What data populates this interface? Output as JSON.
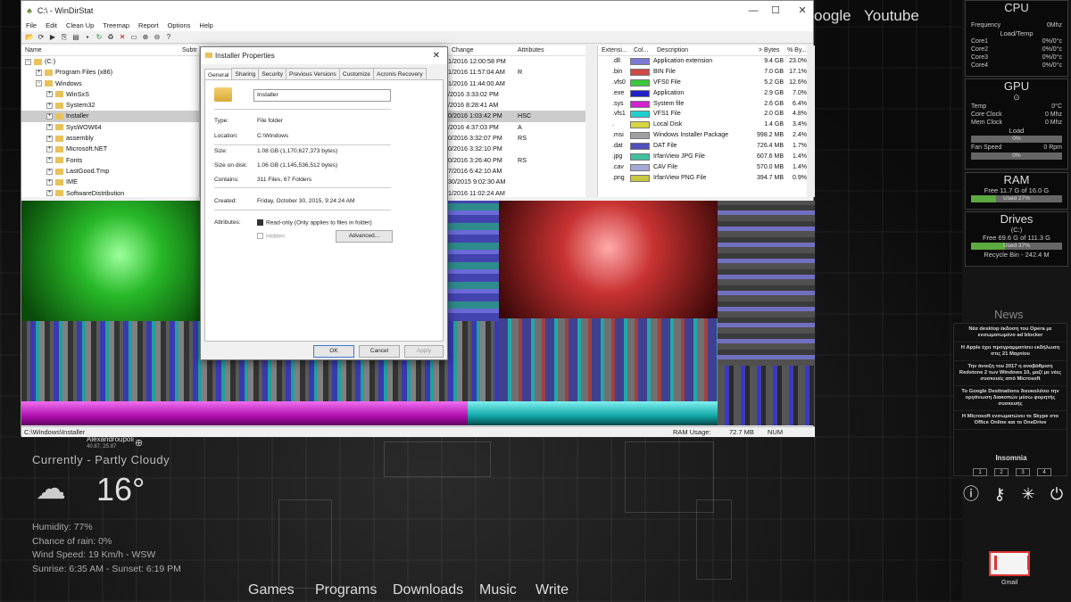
{
  "top_links": [
    "oogle",
    "Youtube"
  ],
  "window": {
    "title": "C:\\ - WinDirStat",
    "min": "—",
    "max": "☐",
    "close": "✕",
    "menu": [
      "File",
      "Edit",
      "Clean Up",
      "Treemap",
      "Report",
      "Options",
      "Help"
    ],
    "tree_headers": {
      "name": "Name",
      "subtree": "Subtr"
    },
    "tree": [
      {
        "label": "(C:)",
        "indent": 0,
        "exp": "−"
      },
      {
        "label": "Program Files (x86)",
        "indent": 1,
        "exp": "+"
      },
      {
        "label": "Windows",
        "indent": 1,
        "exp": "−"
      },
      {
        "label": "WinSxS",
        "indent": 2,
        "exp": "+"
      },
      {
        "label": "System32",
        "indent": 2,
        "exp": "+"
      },
      {
        "label": "Installer",
        "indent": 2,
        "exp": "+",
        "sel": true
      },
      {
        "label": "SysWOW64",
        "indent": 2,
        "exp": "+"
      },
      {
        "label": "assembly",
        "indent": 2,
        "exp": "+"
      },
      {
        "label": "Microsoft.NET",
        "indent": 2,
        "exp": "+"
      },
      {
        "label": "Fonts",
        "indent": 2,
        "exp": "+"
      },
      {
        "label": "LastGood.Tmp",
        "indent": 2,
        "exp": "+"
      },
      {
        "label": "IME",
        "indent": 2,
        "exp": "+"
      },
      {
        "label": "SoftwareDistribution",
        "indent": 2,
        "exp": "+"
      }
    ],
    "col_headers": {
      "change": "Change",
      "attributes": "Attributes"
    },
    "col_rows": [
      {
        "c": "1/2016 12:00:58 PM",
        "a": ""
      },
      {
        "c": "1/2016 11:57:04 AM",
        "a": "R"
      },
      {
        "c": "1/2016 11:44:00 AM",
        "a": ""
      },
      {
        "c": "/2016 3:33:02 PM",
        "a": ""
      },
      {
        "c": "/2016 8:28:41 AM",
        "a": ""
      },
      {
        "c": "0/2016 1:03:42 PM",
        "a": "HSC",
        "sel": true
      },
      {
        "c": "/2016 4:37:03 PM",
        "a": "A"
      },
      {
        "c": "0/2016 3:32:07 PM",
        "a": "RS"
      },
      {
        "c": "0/2016 3:32:10 PM",
        "a": ""
      },
      {
        "c": "0/2016 3:26:40 PM",
        "a": "RS"
      },
      {
        "c": "7/2016 6:42:10 AM",
        "a": ""
      },
      {
        "c": "30/2015 9:02:30 AM",
        "a": ""
      },
      {
        "c": "1/2016 11:02:24 AM",
        "a": ""
      }
    ],
    "ext_headers": {
      "ext": "Extensi...",
      "col": "Col...",
      "desc": "Description",
      "bytes": "> Bytes",
      "pct": "% By..."
    },
    "ext_rows": [
      {
        "e": ".dll",
        "color": "#7a7ad6",
        "d": "Application extension",
        "b": "9.4 GB",
        "p": "23.0%"
      },
      {
        "e": ".bin",
        "color": "#d04848",
        "d": "BIN File",
        "b": "7.0 GB",
        "p": "17.1%"
      },
      {
        "e": ".vfs0",
        "color": "#3cc83c",
        "d": "VFS0 File",
        "b": "5.2 GB",
        "p": "12.6%"
      },
      {
        "e": ".exe",
        "color": "#2020c8",
        "d": "Application",
        "b": "2.9 GB",
        "p": "7.0%"
      },
      {
        "e": ".sys",
        "color": "#d020d0",
        "d": "System file",
        "b": "2.6 GB",
        "p": "6.4%"
      },
      {
        "e": ".vfs1",
        "color": "#20d0d0",
        "d": "VFS1 File",
        "b": "2.0 GB",
        "p": "4.8%"
      },
      {
        "e": ".",
        "color": "#d6d640",
        "d": "Local Disk",
        "b": "1.4 GB",
        "p": "3.4%"
      },
      {
        "e": ".msi",
        "color": "#a0a0a0",
        "d": "Windows Installer Package",
        "b": "998.2 MB",
        "p": "2.4%"
      },
      {
        "e": ".dat",
        "color": "#5050b8",
        "d": "DAT File",
        "b": "726.4 MB",
        "p": "1.7%"
      },
      {
        "e": ".jpg",
        "color": "#40c0a0",
        "d": "IrfanView JPG File",
        "b": "607.6 MB",
        "p": "1.4%"
      },
      {
        "e": ".cav",
        "color": "#a8a8d8",
        "d": "CAV File",
        "b": "570.0 MB",
        "p": "1.4%"
      },
      {
        "e": ".png",
        "color": "#c8c840",
        "d": "IrfanView PNG File",
        "b": "394.7 MB",
        "p": "0.9%"
      }
    ],
    "status": {
      "path": "C:\\Windows\\Installer",
      "ram_label": "RAM Usage:",
      "ram_value": "72.7 MB",
      "num": "NUM"
    }
  },
  "dialog": {
    "title": "Installer Properties",
    "close": "✕",
    "tabs": [
      "General",
      "Sharing",
      "Security",
      "Previous Versions",
      "Customize",
      "Acronis Recovery"
    ],
    "name": "Installer",
    "type_label": "Type:",
    "type": "File folder",
    "location_label": "Location:",
    "location": "C:\\Windows",
    "size_label": "Size:",
    "size": "1.08 GB (1,170,627,373 bytes)",
    "disk_label": "Size on disk:",
    "disk": "1.06 GB (1,145,536,512 bytes)",
    "contains_label": "Contains:",
    "contains": "311 Files, 67 Folders",
    "created_label": "Created:",
    "created": "Friday, October 30, 2015, 9:24:24 AM",
    "attrs_label": "Attributes:",
    "readonly": "Read-only (Only applies to files in folder)",
    "hidden": "Hidden",
    "advanced": "Advanced...",
    "ok": "OK",
    "cancel": "Cancel",
    "apply": "Apply"
  },
  "weather": {
    "location": "Alexandroupoli",
    "coords": "40.87, 25.87",
    "current": "Currently - Partly Cloudy",
    "temp": "16°",
    "humidity": "Humidity: 77%",
    "rain": "Chance of rain: 0%",
    "wind": "Wind Speed: 19 Km/h - WSW",
    "sun": "Sunrise: 6:35 AM - Sunset: 6:19 PM"
  },
  "bottom_nav": [
    "Games",
    "Programs",
    "Downloads",
    "Music",
    "Write"
  ],
  "cpu": {
    "title": "CPU",
    "freq_label": "Frequency",
    "freq": "0Mhz",
    "sub": "Load/Temp",
    "cores": [
      {
        "n": "Core1",
        "v": "0%/0°c"
      },
      {
        "n": "Core2",
        "v": "0%/0°c"
      },
      {
        "n": "Core3",
        "v": "0%/0°c"
      },
      {
        "n": "Core4",
        "v": "0%/0°c"
      }
    ]
  },
  "gpu": {
    "title": "GPU",
    "temp_label": "Temp",
    "temp": "0°C",
    "core_label": "Core Clock",
    "core": "0 Mhz",
    "mem_label": "Mem Clock",
    "mem": "0 Mhz",
    "load_label": "Load",
    "load": "0%",
    "fan_label": "Fan Speed",
    "fan": "0 Rpm",
    "fan_pct": "0%"
  },
  "ram": {
    "title": "RAM",
    "free": "Free 11.7 G of 16.0 G",
    "used": "Used 27%",
    "used_frac": 0.27
  },
  "drives": {
    "title": "Drives",
    "drive": "(C:)",
    "free": "Free 69.6 G of 111.3 G",
    "used": "Used 37%",
    "used_frac": 0.37,
    "recycle": "Recycle Bin - 242.4 M"
  },
  "news": {
    "title": "News",
    "items": [
      "Νέα desktop έκδοση του Opera με ενσωματωμένο ad blocker",
      "Η Apple έχει προγραμματίσει εκδήλωση στις 21 Μαρτίου",
      "Την άνοιξη του 2017 η αναβάθμιση Redstone 2 των Windows 10, μαζί με νέες συσκευές από Microsoft",
      "Το Google Destinations διευκολύνει την οργάνωση διακοπών μέσω φορητής συσκευής",
      "Η Microsoft ενσωματώνει το Skype στο Office Online και το OneDrive"
    ],
    "brand": "Insomnia",
    "pages": [
      "1",
      "2",
      "3",
      "4"
    ]
  },
  "gmail_label": "Gmail"
}
